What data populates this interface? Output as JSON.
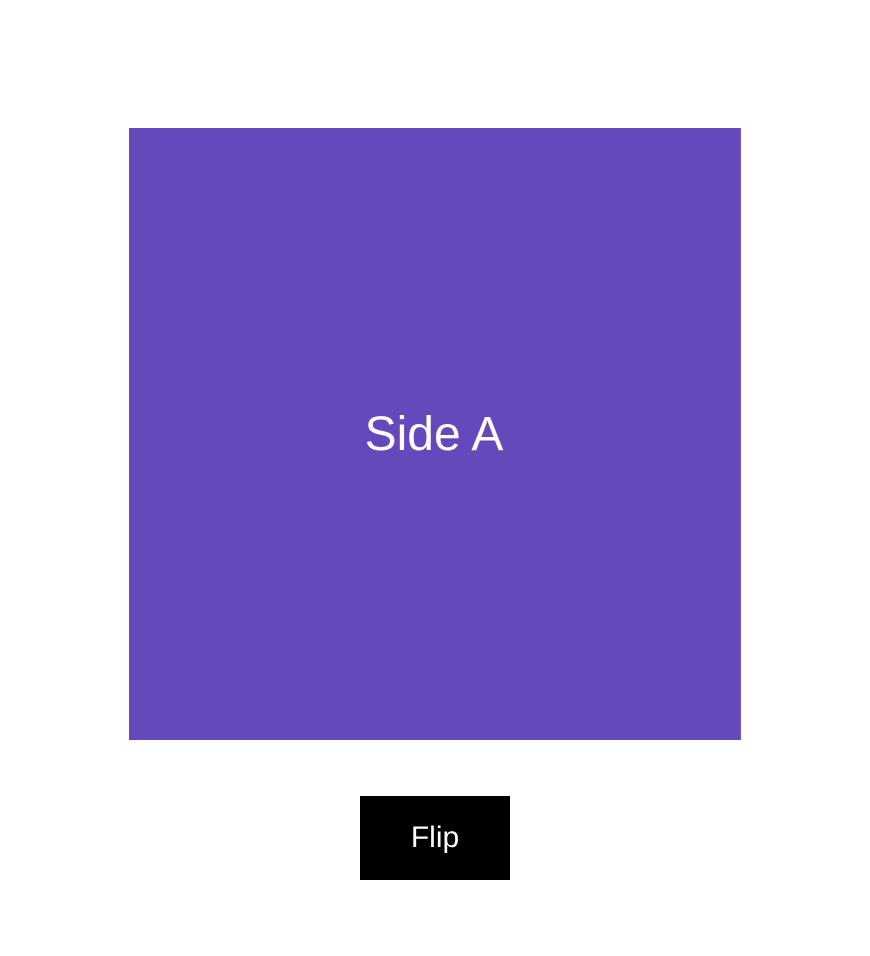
{
  "card": {
    "front_label": "Side A",
    "color": "#6648bd"
  },
  "button": {
    "flip_label": "Flip"
  }
}
